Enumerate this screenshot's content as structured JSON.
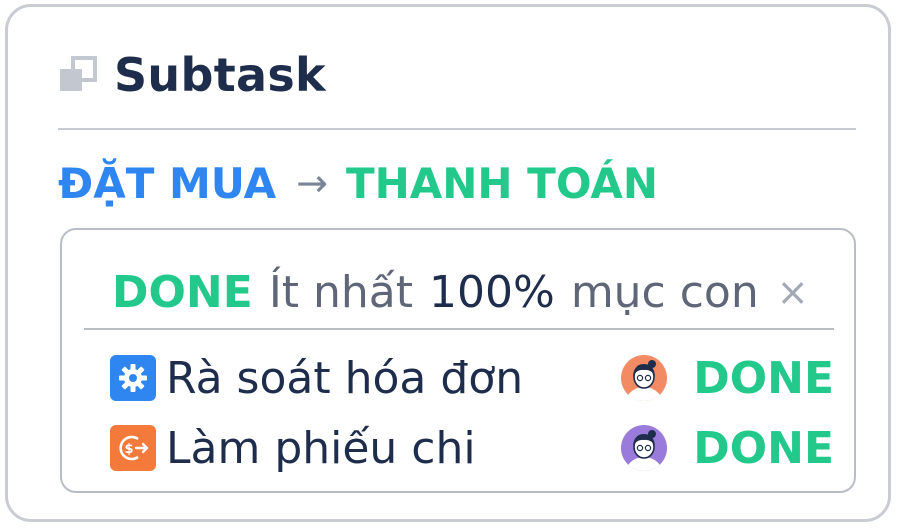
{
  "header": {
    "icon": "subtask-icon",
    "title": "Subtask"
  },
  "transition": {
    "from": "ĐẶT MUA",
    "arrow": "→",
    "to": "THANH TOÁN",
    "colors": {
      "from": "#2f86f0",
      "to": "#22c98a"
    }
  },
  "condition": {
    "status": "DONE",
    "text_before": "Ít nhất",
    "value": "100%",
    "text_after": "mục con",
    "close_icon": "close-icon",
    "close_glyph": "×"
  },
  "items": [
    {
      "icon": "gear-icon",
      "icon_color": "#2f86f0",
      "label": "Rà soát hóa đơn",
      "avatar": "avatar-orange",
      "avatar_color": "#f28a63",
      "status": "DONE"
    },
    {
      "icon": "payment-icon",
      "icon_color": "#f47a3c",
      "label": "Làm phiếu chi",
      "avatar": "avatar-purple",
      "avatar_color": "#9a7bdc",
      "status": "DONE"
    }
  ]
}
